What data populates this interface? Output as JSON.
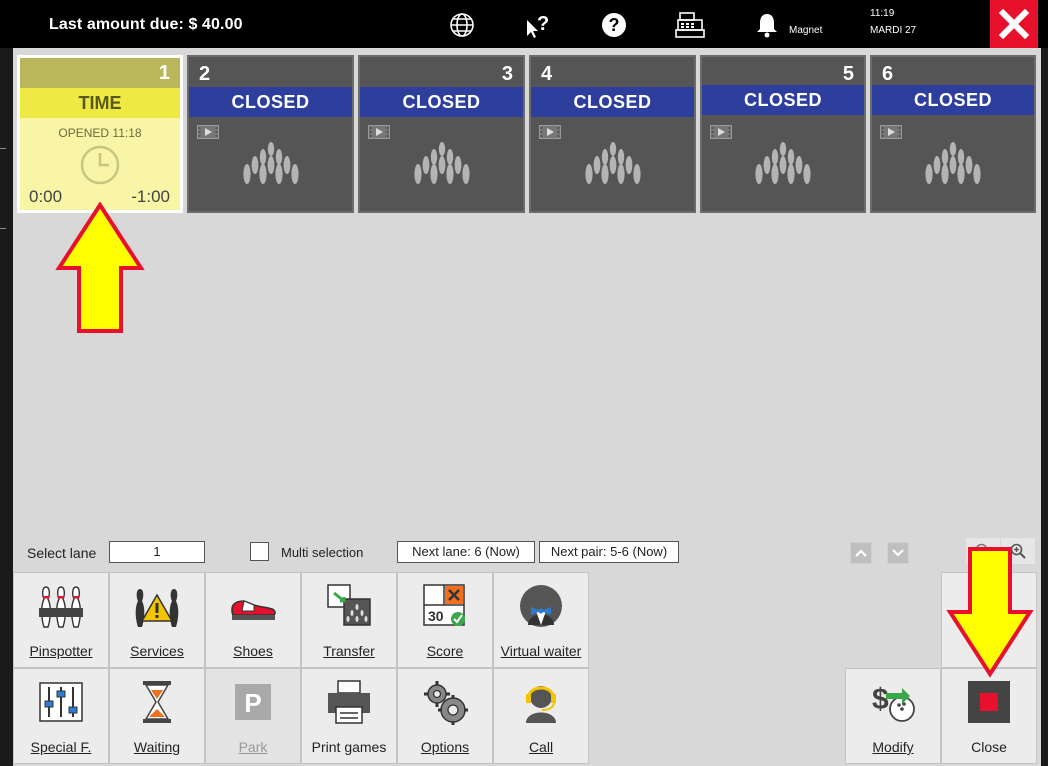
{
  "header": {
    "last_amount_due": "Last amount due: $ 40.00",
    "magnet_label": "Magnet",
    "time": "11:19",
    "date": "MARDI 27",
    "icons": [
      "globe-icon",
      "help-cursor-icon",
      "help-circle-icon",
      "cash-register-icon",
      "bell-icon",
      "exit-icon"
    ]
  },
  "lanes": [
    {
      "number": "1",
      "state": "TIME",
      "opened": "OPENED 11:18",
      "elapsed": "0:00",
      "remaining": "-1:00",
      "active": true
    },
    {
      "number": "2",
      "state": "CLOSED"
    },
    {
      "number": "3",
      "state": "CLOSED"
    },
    {
      "number": "4",
      "state": "CLOSED"
    },
    {
      "number": "5",
      "state": "CLOSED"
    },
    {
      "number": "6",
      "state": "CLOSED"
    }
  ],
  "select_bar": {
    "select_lane_label": "Select lane",
    "select_lane_value": "1",
    "multi_selection_label": "Multi selection",
    "next_lane": "Next lane: 6 (Now)",
    "next_pair": "Next pair: 5-6 (Now)"
  },
  "buttons": {
    "pinspotter": "Pinspotter",
    "services": "Services",
    "shoes": "Shoes",
    "transfer": "Transfer",
    "score": "Score",
    "virtual_waiter": "Virtual waiter",
    "special_f": "Special F.",
    "waiting": "Waiting",
    "park": "Park",
    "print_games": "Print games",
    "options": "Options",
    "call": "Call",
    "modify": "Modify",
    "close": "Close"
  },
  "colors": {
    "closed_banner": "#2d3e9c",
    "active_lane": "#f8f5a7",
    "exit_button": "#e8112d",
    "annotation_arrow": "#ffff00"
  }
}
